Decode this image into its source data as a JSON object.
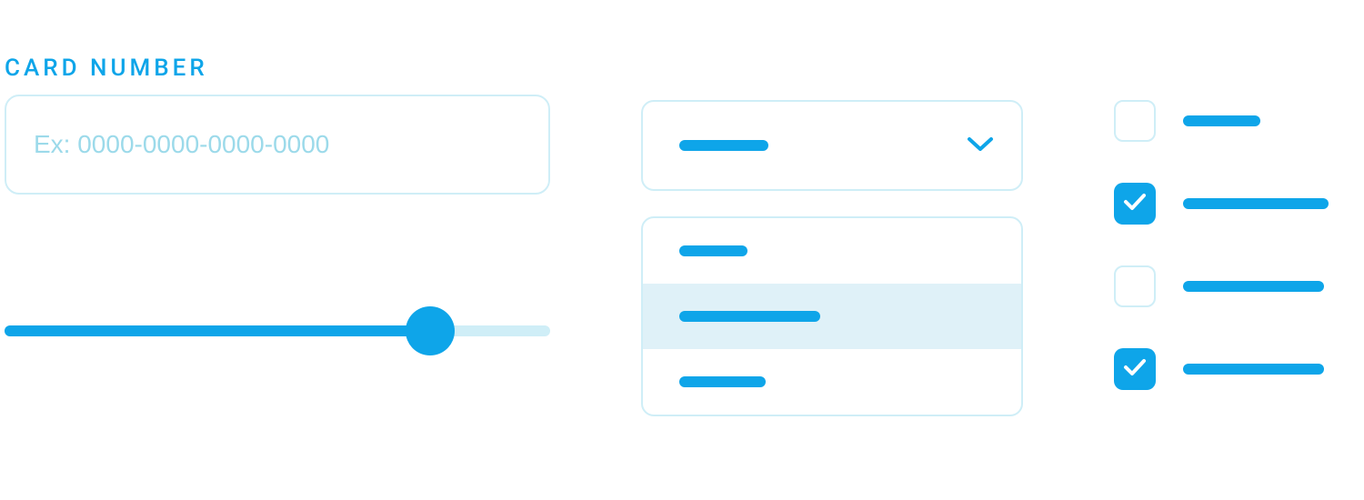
{
  "colors": {
    "primary": "#0ea5e9",
    "light_border": "#cfeef7",
    "hover_bg": "#dff1f8"
  },
  "textInput": {
    "label": "CARD NUMBER",
    "placeholder": "Ex: 0000-0000-0000-0000",
    "value": ""
  },
  "slider": {
    "min": 0,
    "max": 100,
    "value": 78
  },
  "dropdown": {
    "selected_index": 0,
    "hovered_index": 1,
    "options_count": 3
  },
  "checkboxes": [
    {
      "checked": false
    },
    {
      "checked": true
    },
    {
      "checked": false
    },
    {
      "checked": true
    }
  ]
}
